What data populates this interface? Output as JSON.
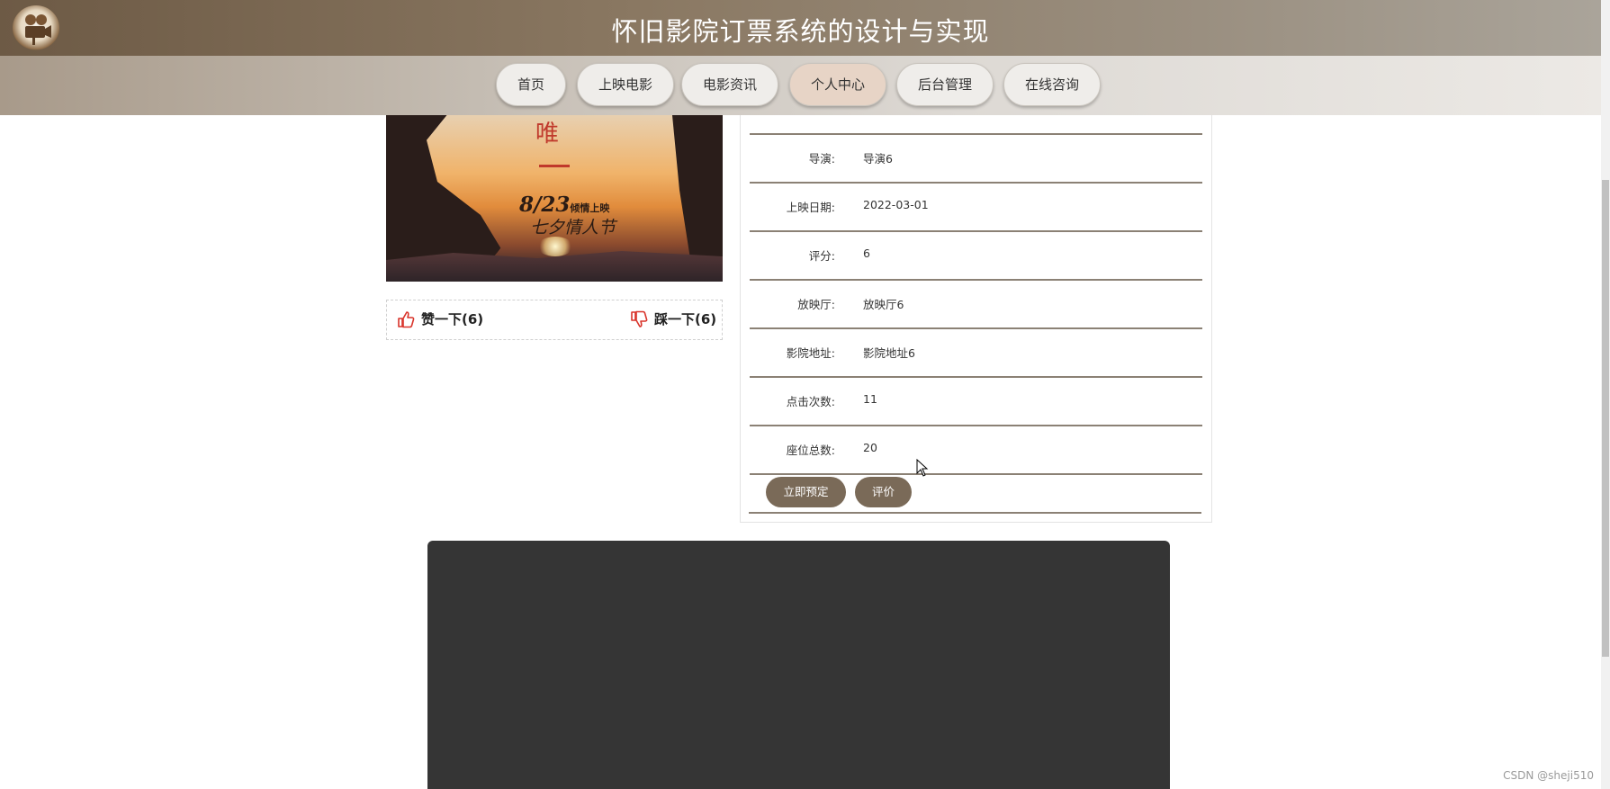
{
  "header": {
    "title": "怀旧影院订票系统的设计与实现",
    "logo_icon": "film-camera-logo"
  },
  "nav": [
    {
      "label": "首页"
    },
    {
      "label": "上映电影"
    },
    {
      "label": "电影资讯"
    },
    {
      "label": "个人中心",
      "active": true
    },
    {
      "label": "后台管理"
    },
    {
      "label": "在线咨询"
    }
  ],
  "poster": {
    "char": "唯",
    "date_text": "8/23",
    "date_sub": "倾情上映",
    "festival": "七夕情人节"
  },
  "votes": {
    "like_label": "赞一下(6)",
    "dislike_label": "踩一下(6)",
    "like_icon": "thumbs-up-icon",
    "dislike_icon": "thumbs-down-icon"
  },
  "details": [
    {
      "label": "导演:",
      "value": "导演6"
    },
    {
      "label": "上映日期:",
      "value": "2022-03-01"
    },
    {
      "label": "评分:",
      "value": "6"
    },
    {
      "label": "放映厅:",
      "value": "放映厅6"
    },
    {
      "label": "影院地址:",
      "value": "影院地址6"
    },
    {
      "label": "点击次数:",
      "value": "11"
    },
    {
      "label": "座位总数:",
      "value": "20"
    }
  ],
  "actions": {
    "book_label": "立即预定",
    "review_label": "评价"
  },
  "watermark": "CSDN @sheji510",
  "colors": {
    "accent": "#7a6a58",
    "header_dark": "#6d5a45",
    "active_nav": "#e7d4c6",
    "video_bg": "#353535"
  }
}
